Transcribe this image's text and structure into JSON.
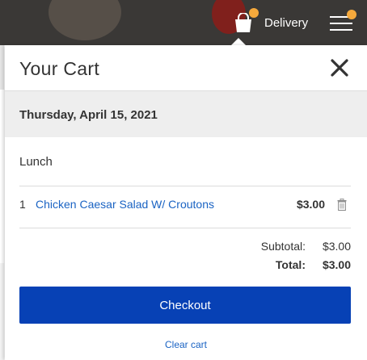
{
  "header": {
    "delivery_label": "Delivery",
    "bag_icon": "shopping-bag-icon",
    "menu_icon": "hamburger-menu-icon",
    "badge_color": "#f5a93c"
  },
  "cart": {
    "title": "Your Cart",
    "close_icon": "close-icon",
    "date": "Thursday, April 15, 2021",
    "meal": "Lunch",
    "items": [
      {
        "qty": "1",
        "name": "Chicken Caesar Salad W/ Croutons",
        "price": "$3.00"
      }
    ],
    "subtotal_label": "Subtotal:",
    "subtotal_value": "$3.00",
    "total_label": "Total:",
    "total_value": "$3.00",
    "checkout_label": "Checkout",
    "clear_label": "Clear cart",
    "accent_color": "#0741b5",
    "link_color": "#1a63c3"
  }
}
